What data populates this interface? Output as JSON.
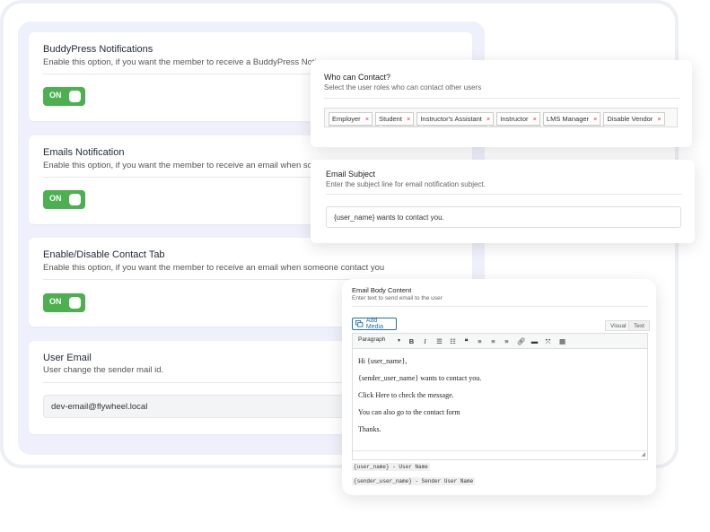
{
  "settings": {
    "buddypress": {
      "title": "BuddyPress Notifications",
      "desc": "Enable this option, if you want the member to receive a BuddyPress Noti",
      "toggle": "ON"
    },
    "emails": {
      "title": "Emails Notification",
      "desc": "Enable this option, if you want the member to receive an email when so",
      "toggle": "ON"
    },
    "contact_tab": {
      "title": "Enable/Disable Contact Tab",
      "desc": "Enable this option, if you want the member to receive an email when someone contact you",
      "toggle": "ON"
    },
    "user_email": {
      "title": "User Email",
      "desc": "User change the sender mail id.",
      "value": "dev-email@flywheel.local"
    }
  },
  "who_can_contact": {
    "title": "Who can Contact?",
    "desc": "Select the user roles who can contact other users",
    "roles": [
      "Employer",
      "Student",
      "Instructor's Assistant",
      "Instructor",
      "LMS Manager",
      "Disable Vendor"
    ],
    "remove_glyph": "×"
  },
  "email_subject": {
    "title": "Email Subject",
    "desc": "Enter the subject line for email notification subject.",
    "value": "{user_name} wants to contact you."
  },
  "email_body": {
    "title": "Email Body Content",
    "desc": "Enter text to send email to the user",
    "add_media": "Add Media",
    "tab_visual": "Visual",
    "tab_text": "Text",
    "format_select": "Paragraph",
    "lines": [
      "Hi {user_name},",
      "{sender_user_name} wants to contact you.",
      "Click Here to check the message.",
      "You can also go to the contact form",
      "Thanks."
    ],
    "hints": [
      "{user_name} - User Name",
      "{sender_user_name} - Sender User Name"
    ]
  },
  "colors": {
    "toggle_on": "#4caf50",
    "panel_bg": "#eef0fb",
    "link_blue": "#2271b1"
  },
  "toolbar_icons": [
    "bold-icon",
    "italic-icon",
    "bullet-list-icon",
    "numbered-list-icon",
    "blockquote-icon",
    "align-left-icon",
    "align-center-icon",
    "align-right-icon",
    "link-icon",
    "horizontal-rule-icon",
    "fullscreen-icon",
    "kitchen-sink-icon"
  ]
}
